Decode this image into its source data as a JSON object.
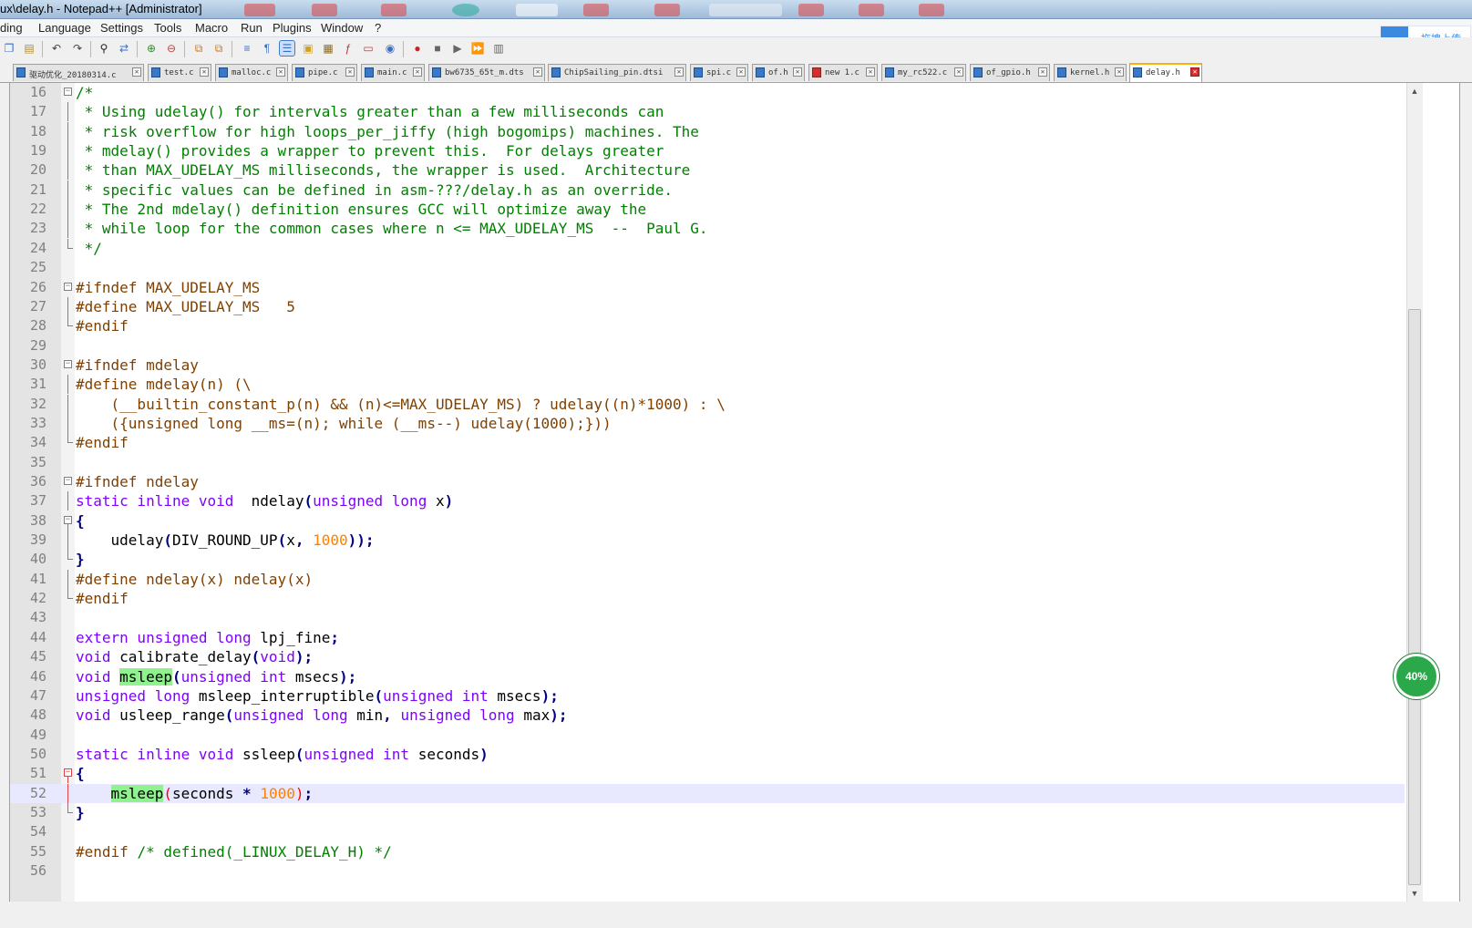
{
  "window": {
    "title": "ux\\delay.h - Notepad++ [Administrator]"
  },
  "menu": {
    "items": [
      "ding",
      "Language",
      "Settings",
      "Tools",
      "Macro",
      "Run",
      "Plugins",
      "Window",
      "?"
    ]
  },
  "cloud_upload": {
    "label": "拖拽上传",
    "icon": "baidu-cloud-icon"
  },
  "toolbar": {
    "icons": [
      "copy-icon",
      "paste-icon",
      "undo-icon",
      "redo-icon",
      "find-icon",
      "replace-icon",
      "zoom-in-icon",
      "zoom-out-icon",
      "sync-vertical-icon",
      "sync-horizontal-icon",
      "word-wrap-icon",
      "show-all-chars-icon",
      "indent-guide-icon",
      "language-icon",
      "doc-map-icon",
      "function-list-icon",
      "folder-as-workspace-icon",
      "monitor-icon",
      "record-macro-icon",
      "stop-record-icon",
      "playback-icon",
      "run-macro-multiple-icon",
      "save-macro-icon"
    ]
  },
  "tabs": [
    {
      "label": "驱动优化_20180314.c",
      "active": false,
      "modified": false
    },
    {
      "label": "test.c",
      "active": false,
      "modified": false
    },
    {
      "label": "malloc.c",
      "active": false,
      "modified": false
    },
    {
      "label": "pipe.c",
      "active": false,
      "modified": false
    },
    {
      "label": "main.c",
      "active": false,
      "modified": false
    },
    {
      "label": "bw6735_65t_m.dts",
      "active": false,
      "modified": false
    },
    {
      "label": "ChipSailing_pin.dtsi",
      "active": false,
      "modified": false
    },
    {
      "label": "spi.c",
      "active": false,
      "modified": false
    },
    {
      "label": "of.h",
      "active": false,
      "modified": false
    },
    {
      "label": "new 1.c",
      "active": false,
      "modified": true
    },
    {
      "label": "my_rc522.c",
      "active": false,
      "modified": false
    },
    {
      "label": "of_gpio.h",
      "active": false,
      "modified": false
    },
    {
      "label": "kernel.h",
      "active": false,
      "modified": false
    },
    {
      "label": "delay.h",
      "active": true,
      "modified": false
    }
  ],
  "editor": {
    "current_line": 52,
    "lines": [
      {
        "n": "16",
        "fold": "start",
        "segs": [
          [
            "c-com",
            "/*"
          ]
        ]
      },
      {
        "n": "17",
        "fold": "mid",
        "segs": [
          [
            "c-com",
            " * Using udelay() for intervals greater than a few milliseconds can"
          ]
        ]
      },
      {
        "n": "18",
        "fold": "mid",
        "segs": [
          [
            "c-com",
            " * risk overflow for high loops_per_jiffy (high bogomips) machines. The"
          ]
        ]
      },
      {
        "n": "19",
        "fold": "mid",
        "segs": [
          [
            "c-com",
            " * mdelay() provides a wrapper to prevent this.  For delays greater"
          ]
        ]
      },
      {
        "n": "20",
        "fold": "mid",
        "segs": [
          [
            "c-com",
            " * than MAX_UDELAY_MS milliseconds, the wrapper is used.  Architecture"
          ]
        ]
      },
      {
        "n": "21",
        "fold": "mid",
        "segs": [
          [
            "c-com",
            " * specific values can be defined in asm-???/delay.h as an override."
          ]
        ]
      },
      {
        "n": "22",
        "fold": "mid",
        "segs": [
          [
            "c-com",
            " * The 2nd mdelay() definition ensures GCC will optimize away the"
          ]
        ]
      },
      {
        "n": "23",
        "fold": "mid",
        "segs": [
          [
            "c-com",
            " * while loop for the common cases where n <= MAX_UDELAY_MS  --  Paul G."
          ]
        ]
      },
      {
        "n": "24",
        "fold": "end",
        "segs": [
          [
            "c-com",
            " */"
          ]
        ]
      },
      {
        "n": "25",
        "fold": "",
        "segs": []
      },
      {
        "n": "26",
        "fold": "start",
        "segs": [
          [
            "c-pp",
            "#ifndef MAX_UDELAY_MS"
          ]
        ]
      },
      {
        "n": "27",
        "fold": "mid",
        "segs": [
          [
            "c-pp",
            "#define MAX_UDELAY_MS   5"
          ]
        ]
      },
      {
        "n": "28",
        "fold": "end",
        "segs": [
          [
            "c-pp",
            "#endif"
          ]
        ]
      },
      {
        "n": "29",
        "fold": "",
        "segs": []
      },
      {
        "n": "30",
        "fold": "start",
        "segs": [
          [
            "c-pp",
            "#ifndef mdelay"
          ]
        ]
      },
      {
        "n": "31",
        "fold": "mid",
        "segs": [
          [
            "c-pp",
            "#define mdelay(n) (\\"
          ]
        ]
      },
      {
        "n": "32",
        "fold": "mid",
        "segs": [
          [
            "c-pp",
            "    (__builtin_constant_p(n) && (n)<=MAX_UDELAY_MS) ? udelay((n)*1000) : \\"
          ]
        ]
      },
      {
        "n": "33",
        "fold": "mid",
        "segs": [
          [
            "c-pp",
            "    ({unsigned long __ms=(n); while (__ms--) udelay(1000);}))"
          ]
        ]
      },
      {
        "n": "34",
        "fold": "end",
        "segs": [
          [
            "c-pp",
            "#endif"
          ]
        ]
      },
      {
        "n": "35",
        "fold": "",
        "segs": []
      },
      {
        "n": "36",
        "fold": "start",
        "segs": [
          [
            "c-pp",
            "#ifndef ndelay"
          ]
        ]
      },
      {
        "n": "37",
        "fold": "mid",
        "segs": [
          [
            "c-kw",
            "static inline void"
          ],
          [
            "",
            "  ndelay"
          ],
          [
            "c-op",
            "("
          ],
          [
            "c-kw",
            "unsigned long"
          ],
          [
            "",
            " x"
          ],
          [
            "c-op",
            ")"
          ]
        ]
      },
      {
        "n": "38",
        "fold": "start2",
        "segs": [
          [
            "c-op",
            "{"
          ]
        ]
      },
      {
        "n": "39",
        "fold": "mid",
        "segs": [
          [
            "",
            "    udelay"
          ],
          [
            "c-op",
            "("
          ],
          [
            "",
            "DIV_ROUND_UP"
          ],
          [
            "c-op",
            "("
          ],
          [
            "",
            "x"
          ],
          [
            "c-op",
            ","
          ],
          [
            "",
            " "
          ],
          [
            "c-num",
            "1000"
          ],
          [
            "c-op",
            "));"
          ]
        ]
      },
      {
        "n": "40",
        "fold": "end",
        "segs": [
          [
            "c-op",
            "}"
          ]
        ]
      },
      {
        "n": "41",
        "fold": "mid",
        "segs": [
          [
            "c-pp",
            "#define ndelay(x) ndelay(x)"
          ]
        ]
      },
      {
        "n": "42",
        "fold": "end",
        "segs": [
          [
            "c-pp",
            "#endif"
          ]
        ]
      },
      {
        "n": "43",
        "fold": "",
        "segs": []
      },
      {
        "n": "44",
        "fold": "",
        "segs": [
          [
            "c-kw",
            "extern unsigned long"
          ],
          [
            "",
            " lpj_fine"
          ],
          [
            "c-op",
            ";"
          ]
        ]
      },
      {
        "n": "45",
        "fold": "",
        "segs": [
          [
            "c-kw",
            "void"
          ],
          [
            "",
            " calibrate_delay"
          ],
          [
            "c-op",
            "("
          ],
          [
            "c-kw",
            "void"
          ],
          [
            "c-op",
            ");"
          ]
        ]
      },
      {
        "n": "46",
        "fold": "",
        "segs": [
          [
            "c-kw",
            "void"
          ],
          [
            "",
            " "
          ],
          [
            "c-hl",
            "msleep"
          ],
          [
            "c-op",
            "("
          ],
          [
            "c-kw",
            "unsigned int"
          ],
          [
            "",
            " msecs"
          ],
          [
            "c-op",
            ");"
          ]
        ]
      },
      {
        "n": "47",
        "fold": "",
        "segs": [
          [
            "c-kw",
            "unsigned long"
          ],
          [
            "",
            " msleep_interruptible"
          ],
          [
            "c-op",
            "("
          ],
          [
            "c-kw",
            "unsigned int"
          ],
          [
            "",
            " msecs"
          ],
          [
            "c-op",
            ");"
          ]
        ]
      },
      {
        "n": "48",
        "fold": "",
        "segs": [
          [
            "c-kw",
            "void"
          ],
          [
            "",
            " usleep_range"
          ],
          [
            "c-op",
            "("
          ],
          [
            "c-kw",
            "unsigned long"
          ],
          [
            "",
            " min"
          ],
          [
            "c-op",
            ","
          ],
          [
            "",
            " "
          ],
          [
            "c-kw",
            "unsigned long"
          ],
          [
            "",
            " max"
          ],
          [
            "c-op",
            ");"
          ]
        ]
      },
      {
        "n": "49",
        "fold": "",
        "segs": []
      },
      {
        "n": "50",
        "fold": "",
        "segs": [
          [
            "c-kw",
            "static inline void"
          ],
          [
            "",
            " ssleep"
          ],
          [
            "c-op",
            "("
          ],
          [
            "c-kw",
            "unsigned int"
          ],
          [
            "",
            " seconds"
          ],
          [
            "c-op",
            ")"
          ]
        ]
      },
      {
        "n": "51",
        "fold": "startred",
        "segs": [
          [
            "c-op",
            "{"
          ]
        ]
      },
      {
        "n": "52",
        "fold": "midred",
        "segs": [
          [
            "",
            "    "
          ],
          [
            "c-hl",
            "msleep"
          ],
          [
            "c-red",
            "("
          ],
          [
            "",
            "seconds "
          ],
          [
            "c-op",
            "*"
          ],
          [
            "",
            " "
          ],
          [
            "c-num",
            "1000"
          ],
          [
            "c-red",
            ")"
          ],
          [
            "c-op",
            ";"
          ]
        ]
      },
      {
        "n": "53",
        "fold": "end",
        "segs": [
          [
            "c-op",
            "}"
          ]
        ]
      },
      {
        "n": "54",
        "fold": "",
        "segs": []
      },
      {
        "n": "55",
        "fold": "",
        "segs": [
          [
            "c-pp",
            "#endif"
          ],
          [
            "",
            " "
          ],
          [
            "c-com",
            "/* defined(_LINUX_DELAY_H) */"
          ]
        ]
      },
      {
        "n": "56",
        "fold": "",
        "segs": []
      }
    ]
  },
  "progress_badge": {
    "value": "40%"
  }
}
